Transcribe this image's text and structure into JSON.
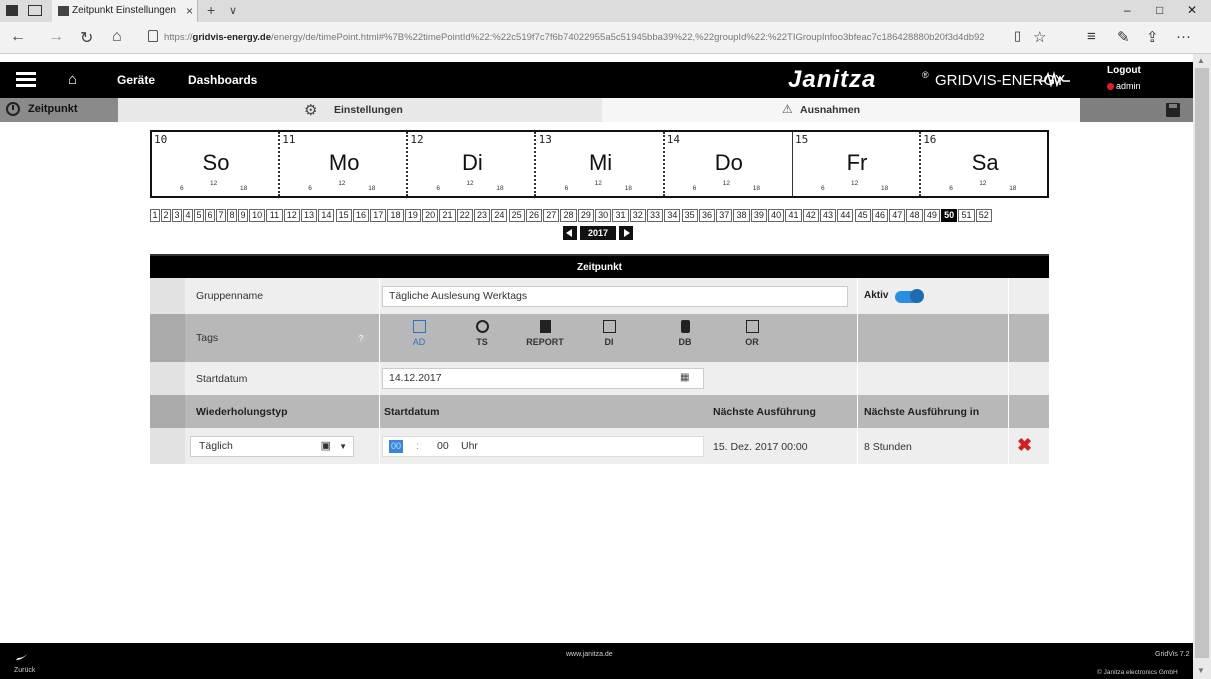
{
  "browser": {
    "tab_title": "Zeitpunkt Einstellungen",
    "tab_close": "×",
    "new_tab": "+",
    "tab_menu": "∨",
    "url_host": "gridvis-energy.de",
    "url_prefix": "https://",
    "url_rest": "/energy/de/timePoint.html#%7B%22timePointId%22:%22c519f7c7f6b74022955a5c51945bba39%22,%22groupId%22:%22TIGroupInfoo3bfeac7c186428880b20f3d4db92",
    "nav": {
      "back": "←",
      "forward": "→",
      "refresh": "↻",
      "home": "⌂"
    },
    "controls": {
      "minimize": "–",
      "maximize": "□",
      "close": "✕",
      "more": "···"
    }
  },
  "app": {
    "nav": {
      "devices": "Geräte",
      "dashboards": "Dashboards"
    },
    "brand": {
      "name": "Janitza",
      "reg": "®",
      "product": "GRIDVIS-ENERGY"
    },
    "user": {
      "logout": "Logout",
      "name": "admin"
    },
    "subnav": {
      "zeitpunkt": "Zeitpunkt",
      "einstellungen": "Einstellungen",
      "ausnahmen": "Ausnahmen"
    }
  },
  "calendar": {
    "days": [
      {
        "num": "10",
        "name": "So"
      },
      {
        "num": "11",
        "name": "Mo"
      },
      {
        "num": "12",
        "name": "Di"
      },
      {
        "num": "13",
        "name": "Mi"
      },
      {
        "num": "14",
        "name": "Do"
      },
      {
        "num": "15",
        "name": "Fr"
      },
      {
        "num": "16",
        "name": "Sa"
      }
    ],
    "ticks": [
      "6",
      "12",
      "18"
    ],
    "weeks": [
      "1",
      "2",
      "3",
      "4",
      "5",
      "6",
      "7",
      "8",
      "9",
      "10",
      "11",
      "12",
      "13",
      "14",
      "15",
      "16",
      "17",
      "18",
      "19",
      "20",
      "21",
      "22",
      "23",
      "24",
      "25",
      "26",
      "27",
      "28",
      "29",
      "30",
      "31",
      "32",
      "33",
      "34",
      "35",
      "36",
      "37",
      "38",
      "39",
      "40",
      "41",
      "42",
      "43",
      "44",
      "45",
      "46",
      "47",
      "48",
      "49",
      "50",
      "51",
      "52"
    ],
    "selected_week": "50",
    "year": "2017"
  },
  "panel": {
    "title": "Zeitpunkt",
    "group_label": "Gruppenname",
    "group_value": "Tägliche Auslesung Werktags",
    "active_label": "Aktiv",
    "tags_label": "Tags",
    "help": "?",
    "tags": [
      {
        "label": "AD",
        "icon": "ad-icon",
        "active": true
      },
      {
        "label": "TS",
        "icon": "ts-icon",
        "active": false
      },
      {
        "label": "REPORT",
        "icon": "report-icon",
        "active": false
      },
      {
        "label": "DI",
        "icon": "di-icon",
        "active": false
      },
      {
        "label": "DB",
        "icon": "db-icon",
        "active": false
      },
      {
        "label": "OR",
        "icon": "or-icon",
        "active": false
      }
    ],
    "startdate_label": "Startdatum",
    "startdate_value": "14.12.2017",
    "headers": {
      "repeat": "Wiederholungstyp",
      "start": "Startdatum",
      "next": "Nächste Ausführung",
      "next_in": "Nächste Ausführung in"
    },
    "schedule": {
      "repeat_type": "Täglich",
      "hour": "00",
      "minute": "00",
      "sep": ":",
      "unit": "Uhr",
      "next": "15. Dez. 2017 00:00",
      "next_in": "8 Stunden"
    }
  },
  "footer": {
    "back": "Zurück",
    "url": "www.janitza.de",
    "version": "GridVis 7.2",
    "copyright": "© Janitza electronics GmbH"
  },
  "colors": {
    "accent": "#2a73c6",
    "header": "#000000",
    "delete": "#d21f1f",
    "row_light": "#eeeeee",
    "row_dark": "#b8b8b8"
  }
}
